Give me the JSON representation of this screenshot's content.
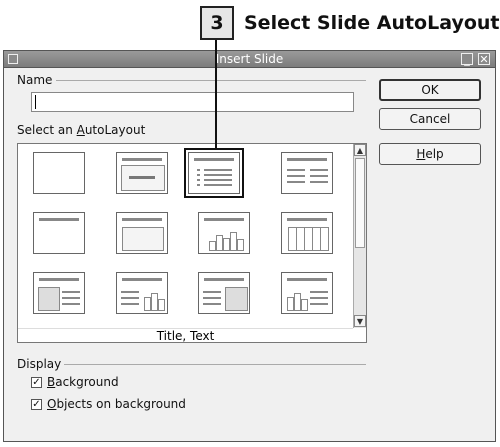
{
  "callout": {
    "step_number": "3",
    "title": "Select Slide AutoLayout"
  },
  "dialog": {
    "title": "Insert Slide",
    "name_label": "Name",
    "name_value": "",
    "autolayout_label_prefix": "Select an ",
    "autolayout_label_accel": "A",
    "autolayout_label_suffix": "utoLayout",
    "selected_layout_caption": "Title, Text",
    "display_label": "Display",
    "background_accel": "B",
    "background_rest": "ackground",
    "objects_accel": "O",
    "objects_rest": "bjects on background",
    "background_checked": true,
    "objects_checked": true
  },
  "buttons": {
    "ok": "OK",
    "cancel": "Cancel",
    "help_accel": "H",
    "help_rest": "elp"
  },
  "layouts": [
    "blank",
    "title-only",
    "title-text",
    "title-2col-text",
    "title-only-line",
    "title-content",
    "title-chart",
    "title-table",
    "title-clipart-text",
    "title-text-chart",
    "title-text-clipart",
    "title-chart-text"
  ],
  "selected_layout": "title-text"
}
